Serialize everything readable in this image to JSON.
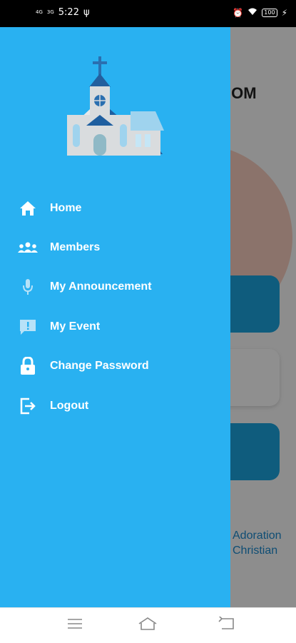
{
  "status_bar": {
    "signal_1": "4G",
    "signal_2": "3G",
    "time": "5:22",
    "battery": "100"
  },
  "background": {
    "title_fragment": ".OM",
    "text_line_1": "Adoration",
    "text_line_2": "Christian"
  },
  "drawer": {
    "items": [
      {
        "label": "Home",
        "icon": "home-icon"
      },
      {
        "label": "Members",
        "icon": "members-icon"
      },
      {
        "label": "My Announcement",
        "icon": "microphone-icon"
      },
      {
        "label": "My Event",
        "icon": "event-message-icon"
      },
      {
        "label": "Change Password",
        "icon": "lock-icon"
      },
      {
        "label": "Logout",
        "icon": "logout-icon"
      }
    ]
  },
  "colors": {
    "drawer_bg": "#29b1f1",
    "accent": "#1a9fd8",
    "menu_text": "#ffffff"
  },
  "nav_bar": {
    "buttons": [
      "menu-icon",
      "home-icon",
      "back-icon"
    ]
  }
}
